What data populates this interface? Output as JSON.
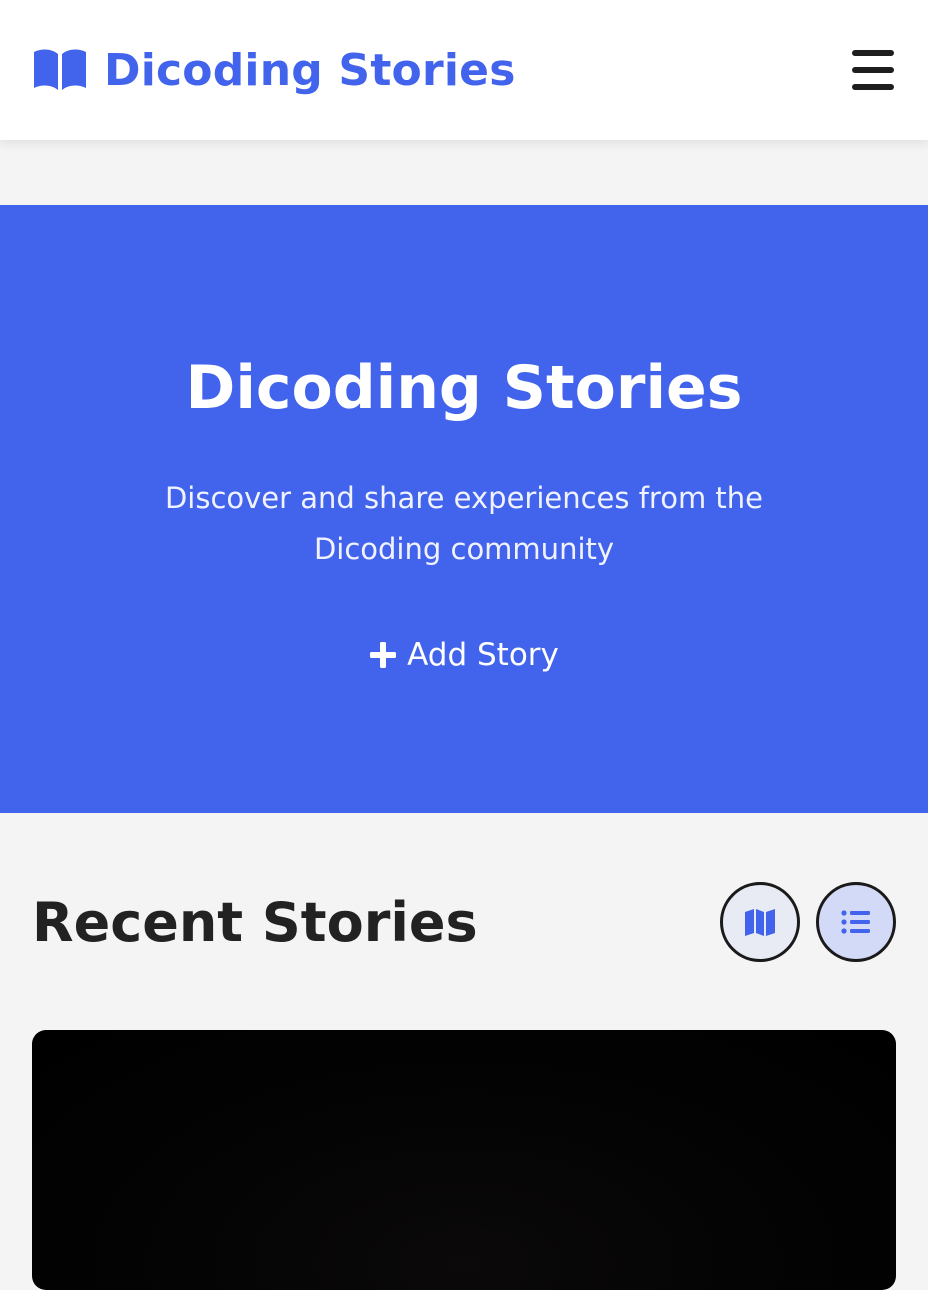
{
  "header": {
    "brand_name": "Dicoding Stories",
    "brand_icon": "open-book-icon",
    "menu_icon": "hamburger-menu-icon"
  },
  "hero": {
    "title": "Dicoding Stories",
    "subtitle": "Discover and share experiences from the Dicoding community",
    "add_story_label": "Add Story"
  },
  "stories_section": {
    "title": "Recent Stories",
    "view_buttons": [
      {
        "icon": "map-icon"
      },
      {
        "icon": "list-icon"
      }
    ]
  },
  "colors": {
    "accent": "#4263eb",
    "header_bg": "#ffffff",
    "page_bg": "#f4f4f4",
    "text_dark": "#222222"
  }
}
